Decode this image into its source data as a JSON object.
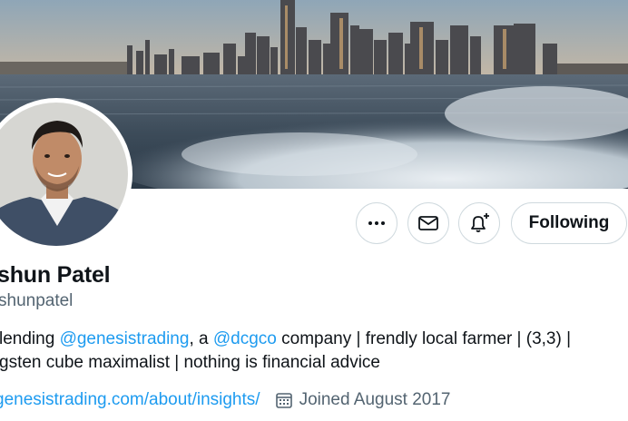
{
  "profile": {
    "display_name": "shun Patel",
    "handle": "shunpatel",
    "bio": {
      "line1_a": "lending ",
      "mention1": "@genesistrading",
      "line1_b": ", a ",
      "mention2": "@dcgco",
      "line1_c": " company | frendly local farmer | (3,3) |",
      "line2": "gsten cube maximalist | nothing is financial advice"
    },
    "website": "genesistrading.com/about/insights/",
    "joined": "Joined August 2017"
  },
  "actions": {
    "following_label": "Following"
  },
  "icons": {
    "more": "more-horizontal-icon",
    "message": "envelope-icon",
    "notify": "bell-plus-icon",
    "calendar": "calendar-icon"
  },
  "colors": {
    "link": "#1d9bf0",
    "secondary_text": "#536471",
    "border": "#cfd9de",
    "text": "#0f1419"
  }
}
